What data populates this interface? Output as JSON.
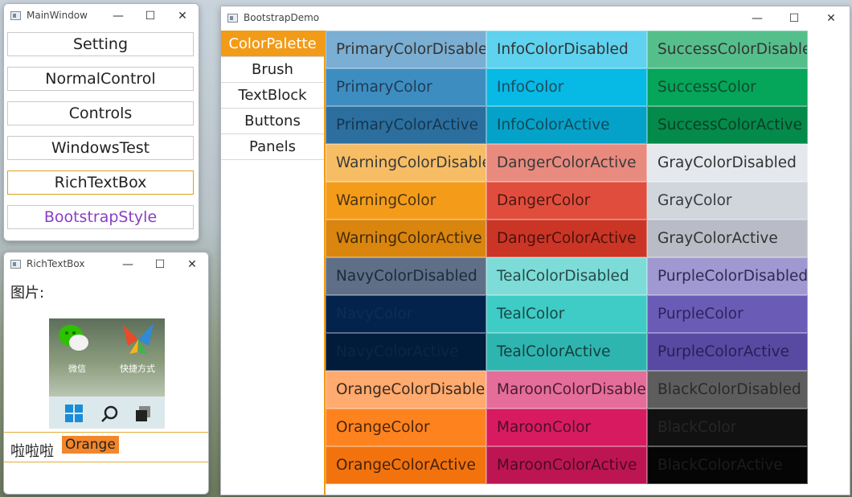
{
  "main_window": {
    "title": "MainWindow",
    "buttons": [
      "Setting",
      "NormalControl",
      "Controls",
      "WindowsTest",
      "RichTextBox",
      "BootstrapStyle"
    ]
  },
  "rich_text_window": {
    "title": "RichTextBox",
    "label": "图片:",
    "image": {
      "icon1_label": "微信",
      "icon2_label": "快捷方式"
    },
    "line_text": "啦啦啦",
    "highlight": "Orange"
  },
  "bootstrap_window": {
    "title": "BootstrapDemo",
    "tabs": [
      "ColorPalette",
      "Brush",
      "TextBlock",
      "Buttons",
      "Panels"
    ],
    "cells": [
      {
        "label": "PrimaryColorDisabled",
        "bg": "#7aaed3",
        "fg": "#333333"
      },
      {
        "label": "InfoColorDisabled",
        "bg": "#5ed2ee",
        "fg": "#333333"
      },
      {
        "label": "SuccessColorDisabled",
        "bg": "#55bf8c",
        "fg": "#333333"
      },
      {
        "label": "PrimaryColor",
        "bg": "#3e8dc1",
        "fg": "#1f3b55"
      },
      {
        "label": "InfoColor",
        "bg": "#07b9e5",
        "fg": "#1e4a5c"
      },
      {
        "label": "SuccessColor",
        "bg": "#05a55a",
        "fg": "#0f4a2c"
      },
      {
        "label": "PrimaryColorActive",
        "bg": "#2c6f9f",
        "fg": "#16354c"
      },
      {
        "label": "InfoColorActive",
        "bg": "#04a2c9",
        "fg": "#134858"
      },
      {
        "label": "SuccessColorActive",
        "bg": "#048a4b",
        "fg": "#0b3d24"
      },
      {
        "label": "WarningColorDisabled",
        "bg": "#f7bd65",
        "fg": "#3a3a3a"
      },
      {
        "label": "DangerColorActive",
        "bg": "#e98a7f",
        "fg": "#3a3a3a"
      },
      {
        "label": "GrayColorDisabled",
        "bg": "#e5e8ec",
        "fg": "#333333"
      },
      {
        "label": "WarningColor",
        "bg": "#f49c1a",
        "fg": "#4a3411"
      },
      {
        "label": "DangerColor",
        "bg": "#e14d3d",
        "fg": "#4b1812"
      },
      {
        "label": "GrayColor",
        "bg": "#d1d5dc",
        "fg": "#3a3a3a"
      },
      {
        "label": "WarningColorActive",
        "bg": "#d9850e",
        "fg": "#432b06"
      },
      {
        "label": "DangerColorActive",
        "bg": "#cb3526",
        "fg": "#4b120c"
      },
      {
        "label": "GrayColorActive",
        "bg": "#b9bcc6",
        "fg": "#333333"
      },
      {
        "label": "NavyColorDisabled",
        "bg": "#5e6f87",
        "fg": "#1d2b3c"
      },
      {
        "label": "TealColorDisabled",
        "bg": "#7ddcd8",
        "fg": "#264a49"
      },
      {
        "label": "PurpleColorDisabled",
        "bg": "#9f98d1",
        "fg": "#2f2a52"
      },
      {
        "label": "NavyColor",
        "bg": "#03234c",
        "fg": "#0c2d55"
      },
      {
        "label": "TealColor",
        "bg": "#3fcbc6",
        "fg": "#174846"
      },
      {
        "label": "PurpleColor",
        "bg": "#6a5cb6",
        "fg": "#2c245b"
      },
      {
        "label": "NavyColorActive",
        "bg": "#011b3a",
        "fg": "#0a2648"
      },
      {
        "label": "TealColorActive",
        "bg": "#2eb5b0",
        "fg": "#133f3d"
      },
      {
        "label": "PurpleColorActive",
        "bg": "#584aa2",
        "fg": "#271f55"
      },
      {
        "label": "OrangeColorDisabled",
        "bg": "#ffaa6e",
        "fg": "#3a2a1e"
      },
      {
        "label": "MaroonColorDisabled",
        "bg": "#e46d99",
        "fg": "#4c1c30"
      },
      {
        "label": "BlackColorDisabled",
        "bg": "#5d5d5d",
        "fg": "#2a2a2a"
      },
      {
        "label": "OrangeColor",
        "bg": "#fe831f",
        "fg": "#4b2509"
      },
      {
        "label": "MaroonColor",
        "bg": "#d81b60",
        "fg": "#4e0f27"
      },
      {
        "label": "BlackColor",
        "bg": "#111111",
        "fg": "#262626"
      },
      {
        "label": "OrangeColorActive",
        "bg": "#f2730e",
        "fg": "#472208"
      },
      {
        "label": "MaroonColorActive",
        "bg": "#bd1552",
        "fg": "#4a0c22"
      },
      {
        "label": "BlackColorActive",
        "bg": "#050505",
        "fg": "#1c1c1c"
      }
    ]
  }
}
